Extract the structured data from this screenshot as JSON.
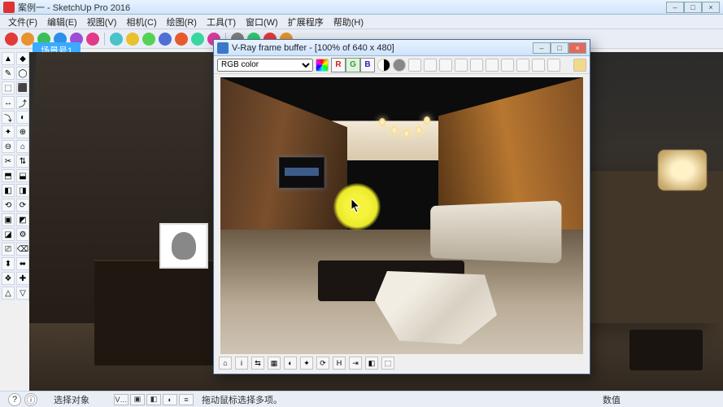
{
  "window": {
    "title": "案例一 - SketchUp Pro 2016",
    "min": "–",
    "max": "□",
    "close": "×"
  },
  "menus": [
    "文件(F)",
    "编辑(E)",
    "视图(V)",
    "相机(C)",
    "绘图(R)",
    "工具(T)",
    "窗口(W)",
    "扩展程序",
    "帮助(H)"
  ],
  "scene_tab": "场景号1",
  "status": {
    "help_icon": "?",
    "info_icon": "ⓘ",
    "tray_v": "V…",
    "hint": "拖动鼠标选择多项。",
    "hint_prefix": "选择对象",
    "value_label": "数值"
  },
  "vfb": {
    "title": "V-Ray frame buffer - [100% of 640 x 480]",
    "min": "–",
    "max": "□",
    "close": "×",
    "channel_select": "RGB color",
    "channels": {
      "r": "R",
      "g": "G",
      "b": "B"
    },
    "bottom_icons": [
      "⌂",
      "i",
      "⇆",
      "▦",
      "◐",
      "✦",
      "⟳",
      "H",
      "⇥",
      "◧",
      "⬚"
    ]
  },
  "toolbar_colors": [
    "#e23a3a",
    "#e7932e",
    "#3abf57",
    "#2e8fe7",
    "#9b4fd6",
    "#e23a8a",
    "#49c2c9",
    "#e7c12e",
    "#55d255",
    "#4f6fd6",
    "#e75a2e",
    "#3ad6a0",
    "#d63a9b",
    "#7e7e7e",
    "#2ec96f",
    "#e23a3a",
    "#e7932e"
  ]
}
